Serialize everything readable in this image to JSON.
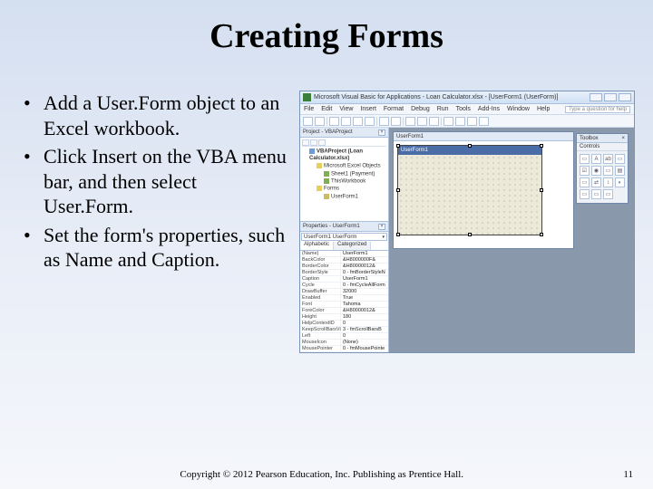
{
  "title": "Creating Forms",
  "bullets": [
    "Add a User.Form object to an Excel workbook.",
    "Click Insert on the VBA menu bar, and then select User.Form.",
    "Set the form's properties, such as Name and Caption."
  ],
  "vba": {
    "titlebar": "Microsoft Visual Basic for Applications - Loan Calculator.xlsx - [UserForm1 (UserForm)]",
    "menus": [
      "File",
      "Edit",
      "View",
      "Insert",
      "Format",
      "Debug",
      "Run",
      "Tools",
      "Add-Ins",
      "Window",
      "Help"
    ],
    "help_placeholder": "Type a question for help",
    "project": {
      "header": "Project - VBAProject",
      "root": "VBAProject (Loan Calculator.xlsx)",
      "excel_objects": "Microsoft Excel Objects",
      "sheet1": "Sheet1 (Payment)",
      "workbook": "ThisWorkbook",
      "forms_folder": "Forms",
      "form1": "UserForm1"
    },
    "properties": {
      "header": "Properties - UserForm1",
      "tabs": [
        "Alphabetic",
        "Categorized"
      ],
      "dropdown": "UserForm1 UserForm",
      "rows": [
        {
          "k": "(Name)",
          "v": "UserForm1"
        },
        {
          "k": "BackColor",
          "v": "&H8000000F&"
        },
        {
          "k": "BorderColor",
          "v": "&H80000012&"
        },
        {
          "k": "BorderStyle",
          "v": "0 - fmBorderStyleN"
        },
        {
          "k": "Caption",
          "v": "UserForm1"
        },
        {
          "k": "Cycle",
          "v": "0 - fmCycleAllForm"
        },
        {
          "k": "DrawBuffer",
          "v": "32000"
        },
        {
          "k": "Enabled",
          "v": "True"
        },
        {
          "k": "Font",
          "v": "Tahoma"
        },
        {
          "k": "ForeColor",
          "v": "&H80000012&"
        },
        {
          "k": "Height",
          "v": "180"
        },
        {
          "k": "HelpContextID",
          "v": "0"
        },
        {
          "k": "KeepScrollBarsVi",
          "v": "3 - fmScrollBarsB"
        },
        {
          "k": "Left",
          "v": "0"
        },
        {
          "k": "MouseIcon",
          "v": "(None)"
        },
        {
          "k": "MousePointer",
          "v": "0 - fmMousePointe"
        }
      ]
    },
    "form_window_title": "UserForm1",
    "userform_caption": "UserForm1",
    "toolbox": {
      "title": "Toolbox",
      "controls_tab": "Controls",
      "items": [
        "▭",
        "A",
        "ab",
        "▭",
        "☑",
        "◉",
        "▭",
        "▤",
        "▭",
        "⇄",
        "↕",
        "◐",
        "▭",
        "▭",
        "▭"
      ]
    }
  },
  "footer": {
    "copyright": "Copyright © 2012 Pearson Education, Inc. Publishing as Prentice Hall.",
    "page": "11"
  }
}
